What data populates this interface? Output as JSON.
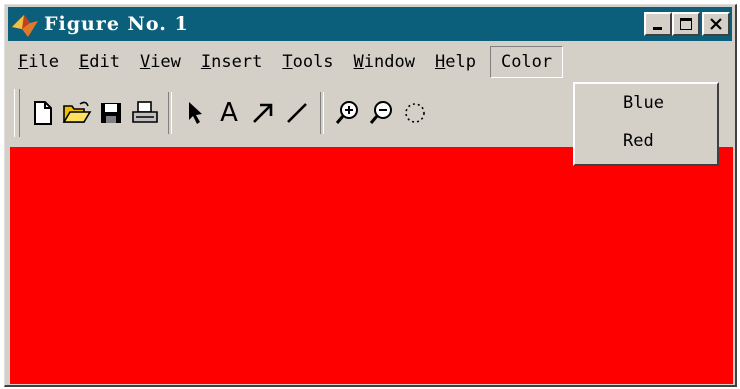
{
  "window": {
    "title": "Figure No. 1",
    "controls": [
      "minimize",
      "maximize",
      "close"
    ]
  },
  "menubar": {
    "items": [
      {
        "first": "F",
        "rest": "ile"
      },
      {
        "first": "E",
        "rest": "dit"
      },
      {
        "first": "V",
        "rest": "iew"
      },
      {
        "first": "I",
        "rest": "nsert"
      },
      {
        "first": "T",
        "rest": "ools"
      },
      {
        "first": "W",
        "rest": "indow"
      },
      {
        "first": "H",
        "rest": "elp"
      }
    ],
    "active": "Color"
  },
  "toolbar": {
    "icons": [
      "new-file-icon",
      "open-folder-icon",
      "save-icon",
      "print-icon",
      "arrow-pointer-icon",
      "text-icon",
      "arrow-line-icon",
      "line-icon",
      "zoom-in-icon",
      "zoom-out-icon",
      "rotate-icon"
    ],
    "text_button": "A"
  },
  "dropdown": {
    "items": [
      "Blue",
      "Red"
    ]
  },
  "canvas": {
    "color": "#ff0000"
  }
}
